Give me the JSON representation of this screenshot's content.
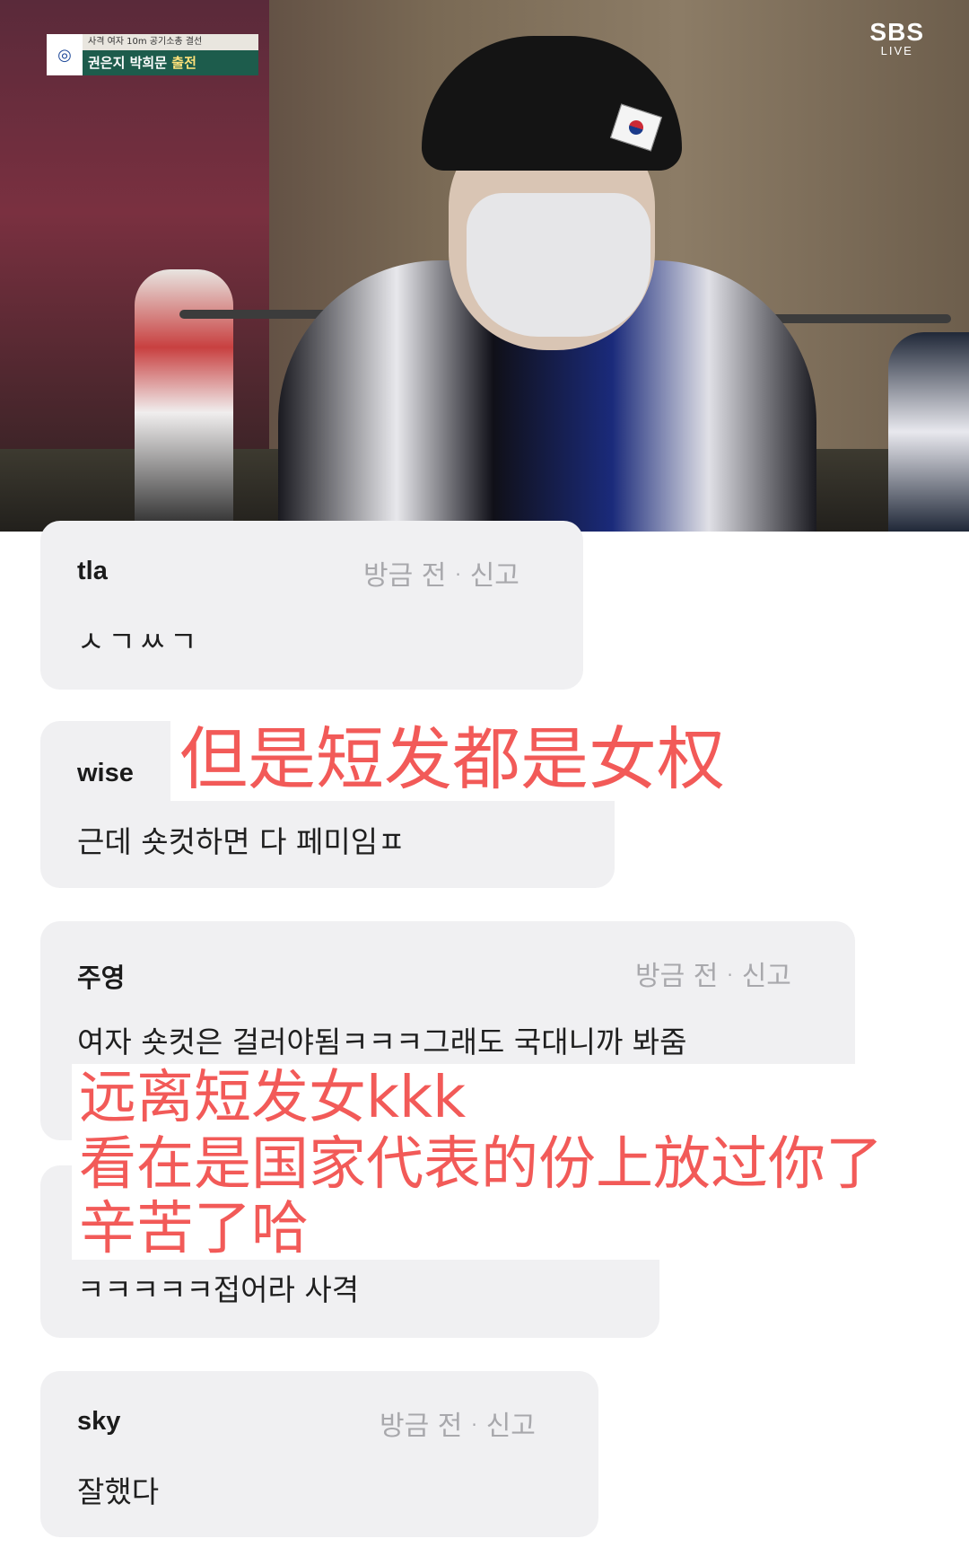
{
  "broadcast": {
    "event_title": "사격 여자 10m 공기소총 결선",
    "players_names": "권은지 박희문",
    "players_status": "출전",
    "network": "SBS",
    "network_sub": "LIVE"
  },
  "comments": [
    {
      "user": "tla",
      "time": "방금 전",
      "report": "신고",
      "text": "ㅅㄱㅆㄱ"
    },
    {
      "user": "wise",
      "text": "근데 숏컷하면 다 페미임ㅍ"
    },
    {
      "user": "주영",
      "time": "방금 전",
      "report": "신고",
      "text": "여자 숏컷은 걸러야됨ㅋㅋㅋ그래도 국대니까 봐줌"
    },
    {
      "text": "ㅋㅋㅋㅋㅋ접어라 사격"
    },
    {
      "user": "sky",
      "time": "방금 전",
      "report": "신고",
      "text": "잘했다"
    }
  ],
  "annotations": {
    "a1": "但是短发都是女权",
    "a2_line1": "远离短发女kkk",
    "a2_line2": "看在是国家代表的份上放过你了",
    "a2_line3": "辛苦了哈"
  },
  "colors": {
    "annotation": "#f25a58",
    "bubble": "#f0f0f2",
    "meta": "#a8a8ac",
    "badge_green": "#1d5c4c"
  }
}
